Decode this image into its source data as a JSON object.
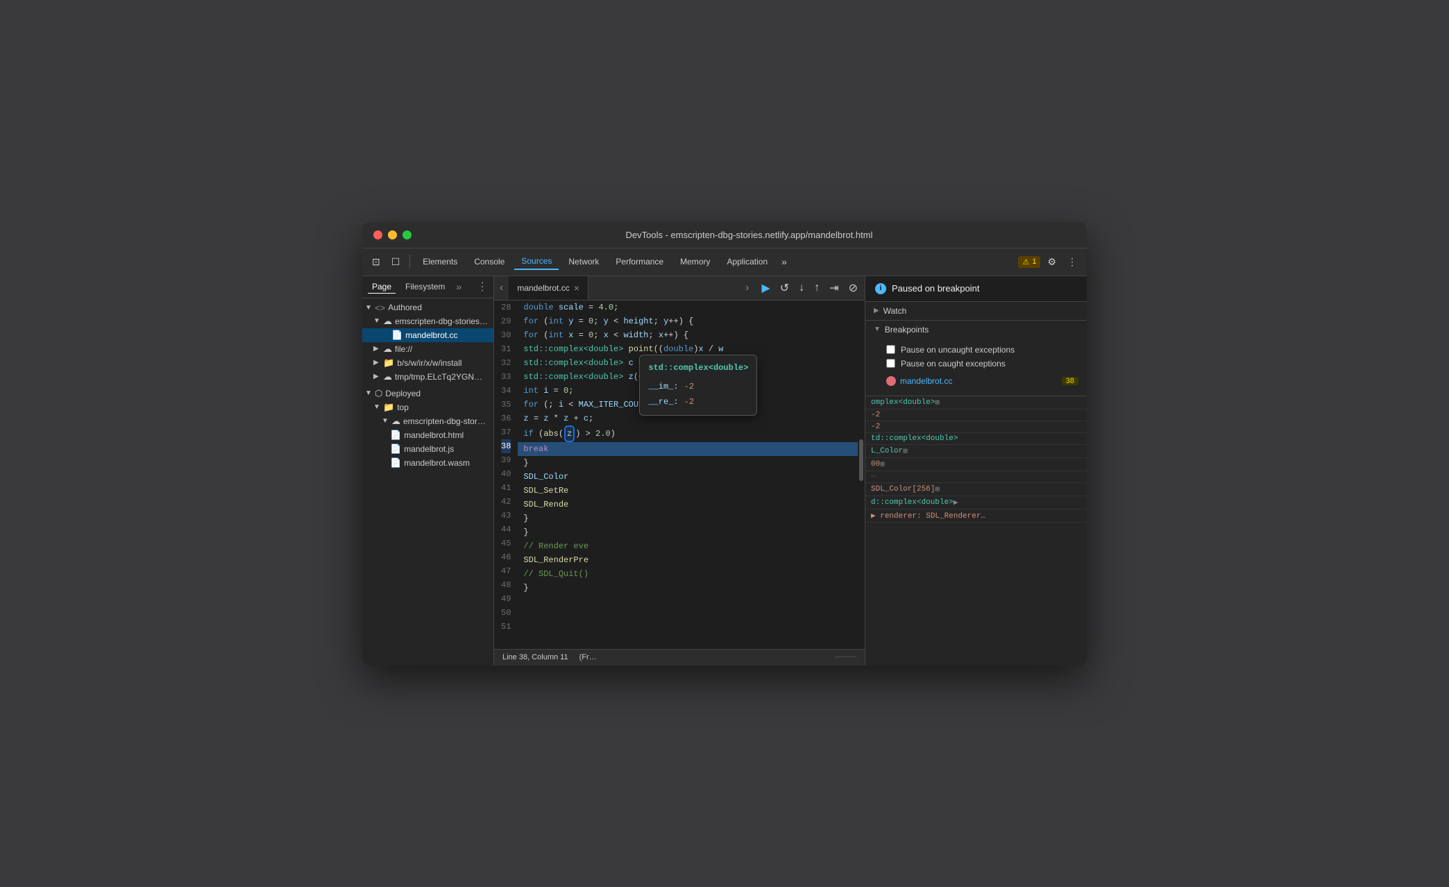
{
  "window": {
    "title": "DevTools - emscripten-dbg-stories.netlify.app/mandelbrot.html"
  },
  "toolbar": {
    "inspect_icon": "⊡",
    "device_icon": "□",
    "elements_label": "Elements",
    "console_label": "Console",
    "sources_label": "Sources",
    "network_label": "Network",
    "performance_label": "Performance",
    "memory_label": "Memory",
    "application_label": "Application",
    "more_icon": "»",
    "warning_count": "1",
    "settings_icon": "⚙",
    "dots_icon": "⋮"
  },
  "sidebar": {
    "tab_page": "Page",
    "tab_filesystem": "Filesystem",
    "more_icon": "»",
    "menu_icon": "⋮",
    "tree": [
      {
        "id": "authored",
        "label": "Authored",
        "type": "group",
        "indent": 0,
        "expanded": true,
        "icon": "<>"
      },
      {
        "id": "emscripten-dbg-stories",
        "label": "emscripten-dbg-stories…",
        "type": "cloud",
        "indent": 1,
        "expanded": true
      },
      {
        "id": "mandelbrot-cc",
        "label": "mandelbrot.cc",
        "type": "file",
        "indent": 2,
        "selected": true
      },
      {
        "id": "file",
        "label": "file://",
        "type": "cloud",
        "indent": 1,
        "expanded": false
      },
      {
        "id": "bsw",
        "label": "b/s/w/ir/x/w/install",
        "type": "folder",
        "indent": 1,
        "expanded": false
      },
      {
        "id": "tmp",
        "label": "tmp/tmp.ELcTq2YGN…",
        "type": "cloud",
        "indent": 1,
        "expanded": false
      },
      {
        "id": "deployed",
        "label": "Deployed",
        "type": "package",
        "indent": 0,
        "expanded": true
      },
      {
        "id": "top",
        "label": "top",
        "type": "folder",
        "indent": 1,
        "expanded": true
      },
      {
        "id": "emscripten-dbg-stor2",
        "label": "emscripten-dbg-stor…",
        "type": "cloud",
        "indent": 2,
        "expanded": true
      },
      {
        "id": "mandelbrot-html",
        "label": "mandelbrot.html",
        "type": "file-html",
        "indent": 3
      },
      {
        "id": "mandelbrot-js",
        "label": "mandelbrot.js",
        "type": "file-js",
        "indent": 3
      },
      {
        "id": "mandelbrot-wasm",
        "label": "mandelbrot.wasm",
        "type": "file-wasm",
        "indent": 3
      }
    ]
  },
  "editor": {
    "filename": "mandelbrot.cc",
    "lines": [
      {
        "num": 28,
        "content": "  double scale = 4.0;",
        "highlight": false,
        "breakpoint": false
      },
      {
        "num": 29,
        "content": "  for (int y = 0; y < height; y++) {",
        "highlight": false,
        "breakpoint": false
      },
      {
        "num": 30,
        "content": "    for (int x = 0; x < width; x++) {",
        "highlight": false,
        "breakpoint": false
      },
      {
        "num": 31,
        "content": "      std::complex<double> point((double)x / w",
        "highlight": false,
        "breakpoint": false
      },
      {
        "num": 32,
        "content": "      std::complex<double> c = (point - cente",
        "highlight": false,
        "breakpoint": false
      },
      {
        "num": 33,
        "content": "      std::complex<double> z(0, 0);",
        "highlight": false,
        "breakpoint": false
      },
      {
        "num": 34,
        "content": "      int i = 0;",
        "highlight": false,
        "breakpoint": false
      },
      {
        "num": 35,
        "content": "      for (; i < MAX_ITER_COUNT - 1; i++) {",
        "highlight": false,
        "breakpoint": false
      },
      {
        "num": 36,
        "content": "        z = z * z + c;",
        "highlight": false,
        "breakpoint": false
      },
      {
        "num": 37,
        "content": "        if (abs(z) > 2.0)",
        "highlight": false,
        "breakpoint": false
      },
      {
        "num": 38,
        "content": "          break",
        "highlight": true,
        "breakpoint": true
      },
      {
        "num": 39,
        "content": "      }",
        "highlight": false,
        "breakpoint": false
      },
      {
        "num": 40,
        "content": "      SDL_Color",
        "highlight": false,
        "breakpoint": false
      },
      {
        "num": 41,
        "content": "      SDL_SetRe",
        "highlight": false,
        "breakpoint": false
      },
      {
        "num": 42,
        "content": "      SDL_Rende",
        "highlight": false,
        "breakpoint": false
      },
      {
        "num": 43,
        "content": "    }",
        "highlight": false,
        "breakpoint": false
      },
      {
        "num": 44,
        "content": "  }",
        "highlight": false,
        "breakpoint": false
      },
      {
        "num": 45,
        "content": "",
        "highlight": false,
        "breakpoint": false
      },
      {
        "num": 46,
        "content": "  // Render eve",
        "highlight": false,
        "breakpoint": false
      },
      {
        "num": 47,
        "content": "  SDL_RenderPre",
        "highlight": false,
        "breakpoint": false
      },
      {
        "num": 48,
        "content": "",
        "highlight": false,
        "breakpoint": false
      },
      {
        "num": 49,
        "content": "  // SDL_Quit()",
        "highlight": false,
        "breakpoint": false
      },
      {
        "num": 50,
        "content": "}",
        "highlight": false,
        "breakpoint": false
      },
      {
        "num": 51,
        "content": "",
        "highlight": false,
        "breakpoint": false
      }
    ],
    "status": {
      "line": "Line 38, Column 11",
      "context": "(Fr…"
    }
  },
  "tooltip": {
    "title": "std::complex<double>",
    "fields": [
      {
        "key": "__im_:",
        "val": "-2"
      },
      {
        "key": "__re_:",
        "val": "-2"
      }
    ]
  },
  "right_panel": {
    "paused_label": "Paused on breakpoint",
    "watch_label": "Watch",
    "breakpoints_label": "Breakpoints",
    "pause_uncaught_label": "Pause on uncaught exceptions",
    "pause_caught_label": "Pause on caught exceptions",
    "breakpoint_file": "mandelbrot.cc",
    "breakpoint_line_num": "38",
    "scope_rows": [
      {
        "key": "",
        "val": "omplex<double>⊞",
        "type": "type"
      },
      {
        "key": "",
        "val": "-2",
        "type": "val"
      },
      {
        "key": "",
        "val": "-2",
        "type": "val"
      },
      {
        "key": "",
        "val": "td::complex<double>",
        "type": "type"
      },
      {
        "key": "",
        "val": "L_Color⊞",
        "type": "type"
      },
      {
        "key": "",
        "val": "00⊞",
        "type": "val"
      },
      {
        "key": "",
        "val": "",
        "type": "sep"
      },
      {
        "key": "",
        "val": "SDL_Color[256]⊞",
        "type": "val"
      },
      {
        "key": "",
        "val": "d::complex<double>▶",
        "type": "type"
      },
      {
        "key": "",
        "val": "► renderer: SDL_Renderer…",
        "type": "val"
      }
    ]
  },
  "debug_controls": {
    "resume": "▶",
    "step_over": "↺",
    "step_into": "↓",
    "step_out": "↑",
    "long_resume": "⇥",
    "deactivate": "⊘"
  }
}
